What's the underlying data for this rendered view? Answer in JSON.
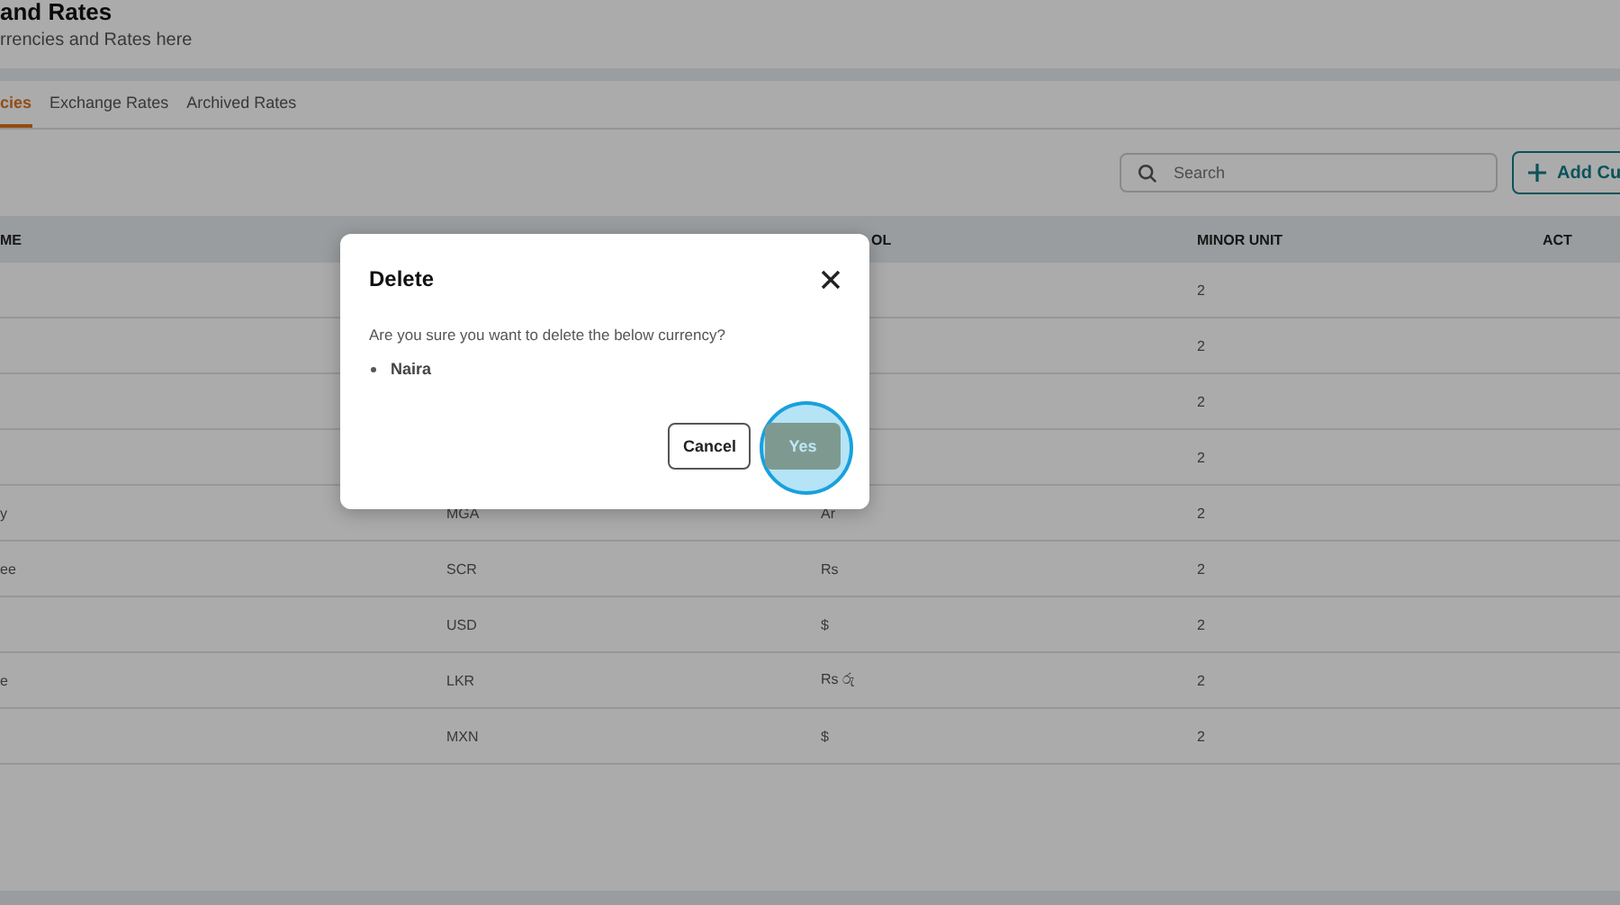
{
  "header": {
    "title": "and Rates",
    "subtitle": "rrencies and Rates here"
  },
  "tabs": [
    {
      "label": "cies",
      "selected": true
    },
    {
      "label": "Exchange Rates",
      "selected": false
    },
    {
      "label": "Archived Rates",
      "selected": false
    }
  ],
  "search": {
    "placeholder": "Search"
  },
  "add_button": {
    "label": "Add Cu"
  },
  "table": {
    "columns": [
      "ME",
      "",
      "OL",
      "MINOR UNIT",
      "ACT"
    ],
    "rows": [
      {
        "minor_unit": "2"
      },
      {
        "minor_unit": "2"
      },
      {
        "minor_unit": "2"
      },
      {
        "minor_unit": "2"
      },
      {
        "name": "y",
        "code": "MGA",
        "symbol": "Ar",
        "minor_unit": "2"
      },
      {
        "name": "ee",
        "code": "SCR",
        "symbol": "Rs",
        "minor_unit": "2"
      },
      {
        "code": "USD",
        "symbol": "$",
        "minor_unit": "2"
      },
      {
        "name": "e",
        "code": "LKR",
        "symbol": "Rs රු",
        "minor_unit": "2"
      },
      {
        "code": "MXN",
        "symbol": "$",
        "minor_unit": "2"
      }
    ]
  },
  "dialog": {
    "title": "Delete",
    "message": "Are you sure you want to delete the below currency?",
    "items": [
      "Naira"
    ],
    "buttons": [
      {
        "label": "Cancel",
        "kind": "secondary"
      },
      {
        "label": "Yes",
        "kind": "primary"
      }
    ]
  }
}
